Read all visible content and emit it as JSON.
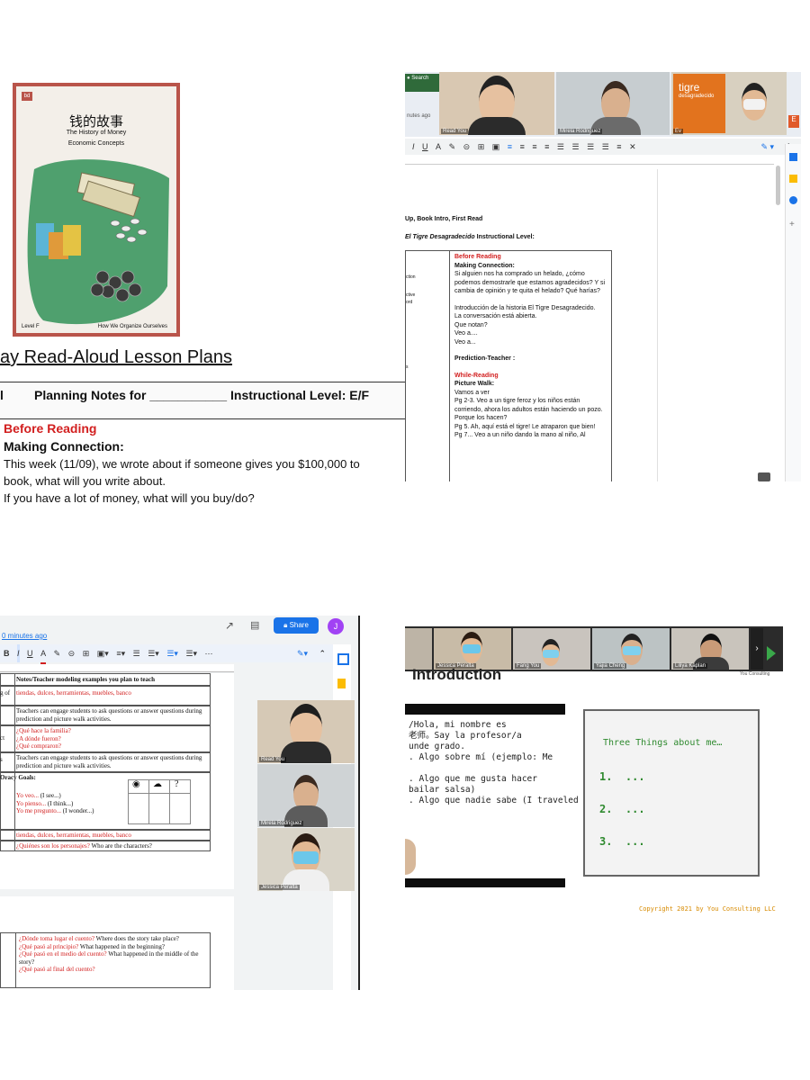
{
  "p1": {
    "book": {
      "logo": "bd",
      "title": "钱的故事",
      "subtitle": "The History of Money",
      "topic": "Economic Concepts",
      "level": "Level F",
      "series": "How We Organize Ourselves"
    },
    "heading": "ay Read-Aloud Lesson Plans",
    "planning": {
      "col_left": "l",
      "planning_notes": "Planning Notes for ___________",
      "instr_level": "Instructional Level:  E/F"
    },
    "before_reading": "Before Reading",
    "making_connection": "Making Connection:",
    "line1": "This week (11/09), we wrote about if someone gives you $100,000 to",
    "line2": "book, what will you write about.",
    "line3": "If you have a lot of money, what will you buy/do?"
  },
  "p2": {
    "participants": [
      {
        "name": "Read You"
      },
      {
        "name": "Mirela Rodriguez"
      },
      {
        "name": "Ev"
      }
    ],
    "browser_tab": "Search",
    "time_ago": "nutes ago",
    "book_cover_title": "tigre",
    "book_cover_sub": "desagradecido",
    "heading1": "Up, Book Intro, First Read",
    "heading2_italic": "El Tigre Desagradecido",
    "heading2_rest": " Instructional Level:",
    "left_labels": [
      "ction",
      "ctive",
      "ord",
      "s"
    ],
    "before_reading": "Before Reading",
    "making_connection": "Making Connection:",
    "para1": "Si alguien nos ha comprado un helado, ¿cómo podemos demostrarle que estamos agradecidos? Y si cambia de opinión y te quita el helado? Qué harías?",
    "intro1": "Introducción de la historia El Tigre Desagradecido.",
    "intro2": "La conversación está abierta.",
    "intro3": "Que notan?",
    "intro4": "Veo a....",
    "intro5": "Veo a...",
    "prediction": "Prediction-Teacher :",
    "while_reading": "While-Reading",
    "picture_walk": "Picture Walk:",
    "pw1": "Vamos a ver",
    "pw2": "Pg 2-3. Veo a un tigre feroz y los niños están corriendo, ahora los adultos están haciendo un pozo. Porque los hacen?",
    "pw3": "Pg 5. Ah, aquí está el tigre! Le atraparon que bien!",
    "pw4": "Pg 7... Veo a un niño dando la mano al niño, Al",
    "toolbar_items": [
      "I",
      "U",
      "A",
      "✎",
      "⊝",
      "⊞",
      "▣",
      "≡",
      "≡",
      "≡",
      "≡",
      "☰",
      "☰",
      "☰",
      "☰",
      "≡",
      "✕"
    ]
  },
  "p3": {
    "time_ago": "0 minutes ago",
    "share": "Share",
    "avatar": "J",
    "table_header": "Notes/Teacher modeling examples you plan to teach",
    "row1_left": "g of",
    "row1": "tiendas, dulces, herramientas, muebles, banco",
    "row2": "Teachers can engage students to ask questions or answer questions during prediction and picture walk activities.",
    "row3_q": [
      "¿Qué hace la familia?",
      "¿A dónde fueron?",
      "¿Qué compraron?"
    ],
    "row3_left": "ct",
    "row4_left": "s",
    "row4": "Teachers can engage students to ask questions or answer questions during prediction and picture walk activities.",
    "oracy_goals": "Oracy Goals:",
    "oracy_lines": [
      {
        "red": "Yo veo...",
        "black": "(I see...)"
      },
      {
        "red": "Yo pienso... ",
        "black": "(I think...)"
      },
      {
        "red": "Yo me pregunto...",
        "black": "(I wonder...)"
      }
    ],
    "row6": "tiendas, dulces, herramientas, muebles, banco",
    "row7_red": "¿Quiénes son los personajes?",
    "row7_black": "Who are the characters?",
    "q2": [
      {
        "red": "¿Dónde toma lugar el cuento?",
        "black": "Where does the story take place?"
      },
      {
        "red": "¿Qué pasó al principio?",
        "black": "What happened in the beginning?"
      },
      {
        "red": "¿Qué pasó en el medio del cuento?",
        "black": "What happened in the middle of the story?"
      },
      {
        "red": "¿Qué pasó al final del cuento?",
        "black": ""
      }
    ],
    "participants": [
      {
        "name": "Read You"
      },
      {
        "name": "Mirela Rodriguez"
      },
      {
        "name": "Jessica Peralta"
      }
    ]
  },
  "p4": {
    "participants": [
      {
        "name": "Jessica Peralta"
      },
      {
        "name": "Fang You"
      },
      {
        "name": "Yajia Cheng"
      },
      {
        "name": "Liliya Kaplan"
      }
    ],
    "brand": "You Consulting",
    "title": "Introduction",
    "lines": [
      "/Hola, mi nombre es",
      "老师。Say la profesor/a",
      "unde grado.",
      ". Algo sobre mí (ejemplo: Me",
      "",
      ". Algo que me gusta hacer",
      "bailar salsa)",
      ". Algo que nadie sabe (I traveled"
    ],
    "box_title": "Three Things about me…",
    "items": [
      "1.  ...",
      "2.  ...",
      "3.  ..."
    ],
    "copyright": "Copyright 2021 by You Consulting LLC"
  },
  "colors": {
    "cover_border": "#b9544a",
    "cover_green": "#4fa06e",
    "red": "#d21f1f",
    "share": "#1a73e8",
    "avatar": "#a142f4",
    "mono_green": "#2f8a2f",
    "copyright": "#d78a00"
  }
}
